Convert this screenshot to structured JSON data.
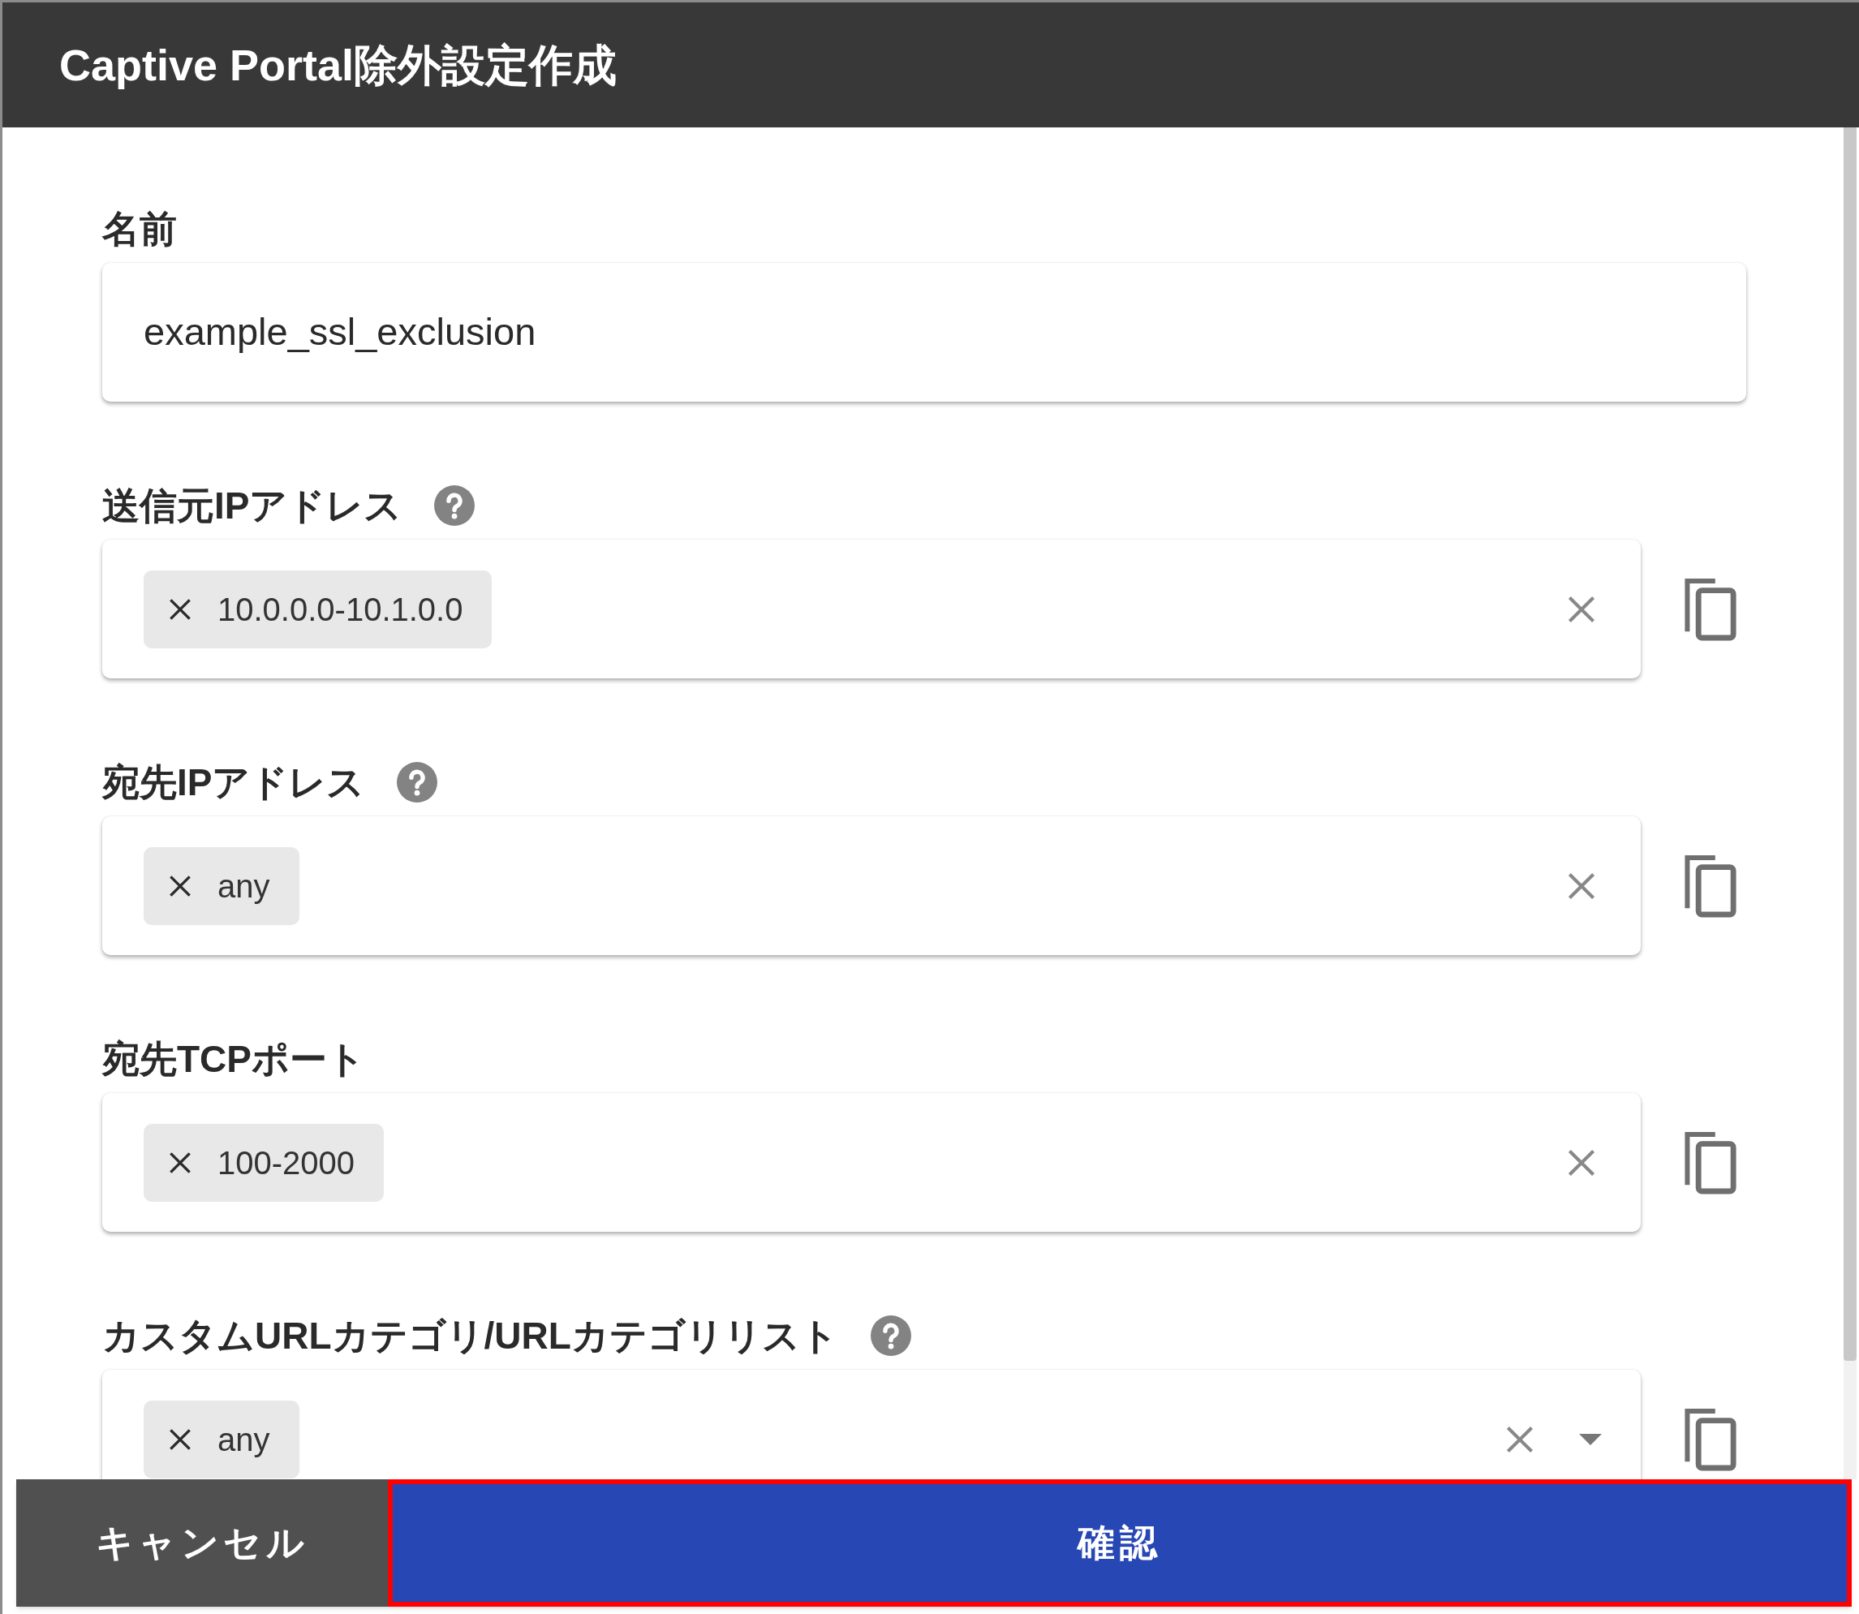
{
  "dialog": {
    "title": "Captive Portal除外設定作成"
  },
  "fields": [
    {
      "kind": "text",
      "label": "名前",
      "help": false,
      "value": "example_ssl_exclusion"
    },
    {
      "kind": "chips",
      "label": "送信元IPアドレス",
      "help": true,
      "chips": [
        "10.0.0.0-10.1.0.0"
      ],
      "dropdown": false
    },
    {
      "kind": "chips",
      "label": "宛先IPアドレス",
      "help": true,
      "chips": [
        "any"
      ],
      "dropdown": false
    },
    {
      "kind": "chips",
      "label": "宛先TCPポート",
      "help": false,
      "chips": [
        "100-2000"
      ],
      "dropdown": false
    },
    {
      "kind": "chips",
      "label": "カスタムURLカテゴリ/URLカテゴリリスト",
      "help": true,
      "chips": [
        "any"
      ],
      "dropdown": true
    }
  ],
  "buttons": [
    {
      "kind": "secondary",
      "label": "キャンセル",
      "focused": false
    },
    {
      "kind": "primary",
      "label": "確認",
      "focused": true
    }
  ]
}
